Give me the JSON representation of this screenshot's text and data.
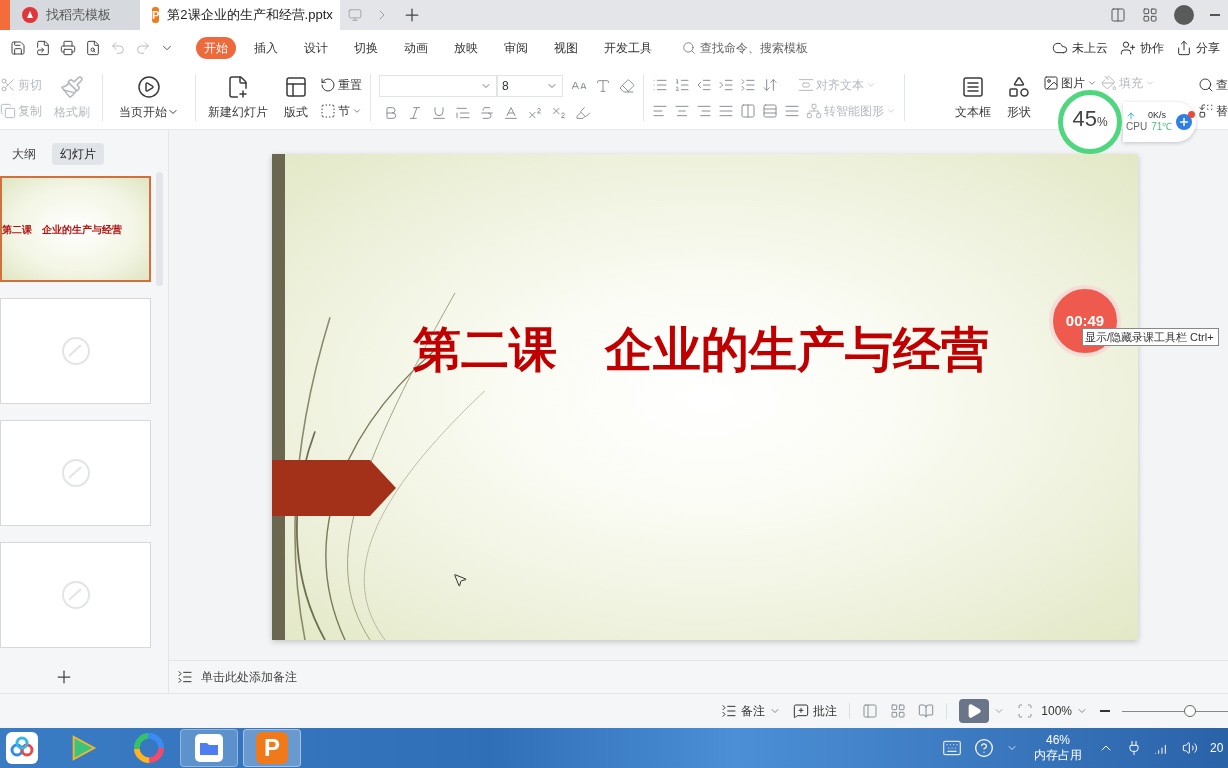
{
  "document_tabs": [
    {
      "label": "找稻壳模板",
      "selected": false,
      "kind": "template"
    },
    {
      "label": "第2课企业的生产和经营.pptx",
      "selected": true,
      "kind": "presentation",
      "letter": "P"
    }
  ],
  "menu": {
    "tabs": [
      {
        "label": "开始",
        "selected": true
      },
      {
        "label": "插入",
        "selected": false
      },
      {
        "label": "设计",
        "selected": false
      },
      {
        "label": "切换",
        "selected": false
      },
      {
        "label": "动画",
        "selected": false
      },
      {
        "label": "放映",
        "selected": false
      },
      {
        "label": "审阅",
        "selected": false
      },
      {
        "label": "视图",
        "selected": false
      },
      {
        "label": "开发工具",
        "selected": false
      }
    ],
    "search": {
      "placeholder": "查找命令、搜索模板"
    },
    "actions": [
      {
        "label": "未上云",
        "kind": "cloud"
      },
      {
        "label": "协作",
        "kind": "collab"
      },
      {
        "label": "分享",
        "kind": "share"
      }
    ]
  },
  "ribbon": {
    "cut": {
      "label": "剪切",
      "disabled": true
    },
    "copy": {
      "label": "复制",
      "disabled": true
    },
    "format_painter": {
      "label": "格式刷",
      "disabled": true
    },
    "start_from_current": {
      "label": "当页开始"
    },
    "new_slide": {
      "label": "新建幻灯片"
    },
    "layout": {
      "label": "版式"
    },
    "reset": {
      "label": "重置"
    },
    "section": {
      "label": "节"
    },
    "font_size": "8",
    "align_text": {
      "label": "对齐文本",
      "disabled": true
    },
    "smart_art": {
      "label": "转智能图形",
      "disabled": true
    },
    "text_box": {
      "label": "文本框"
    },
    "shape": {
      "label": "形状"
    },
    "picture": {
      "label": "图片"
    },
    "fill": {
      "label": "填充",
      "disabled": true
    },
    "find": {
      "label": "查"
    },
    "replace": {
      "label": "替"
    }
  },
  "slides_panel": {
    "tabs": [
      {
        "label": "大纲",
        "selected": false
      },
      {
        "label": "幻灯片",
        "selected": true
      }
    ],
    "thumbnails": [
      {
        "title": "第二课　企业的生产与经营",
        "selected": true
      },
      {
        "selected": false
      },
      {
        "selected": false
      },
      {
        "selected": false
      }
    ]
  },
  "slide": {
    "title": "第二课　企业的生产与经营"
  },
  "notes": {
    "placeholder": "单击此处添加备注"
  },
  "status_bar": {
    "notes": "备注",
    "comments": "批注",
    "zoom": "100%",
    "zoom_slider": {
      "level": 0.64
    }
  },
  "system_monitor": {
    "percent": "45",
    "unit": "%",
    "network": "0K/s",
    "cpu_label": "CPU",
    "cpu_temp": "71℃"
  },
  "recorder": {
    "time": "00:49",
    "tooltip": "显示/隐藏录课工具栏 Ctrl+"
  },
  "taskbar": {
    "wps_letter": "P",
    "memory_percent": "46%",
    "memory_label": "内存占用",
    "clock": "20"
  }
}
